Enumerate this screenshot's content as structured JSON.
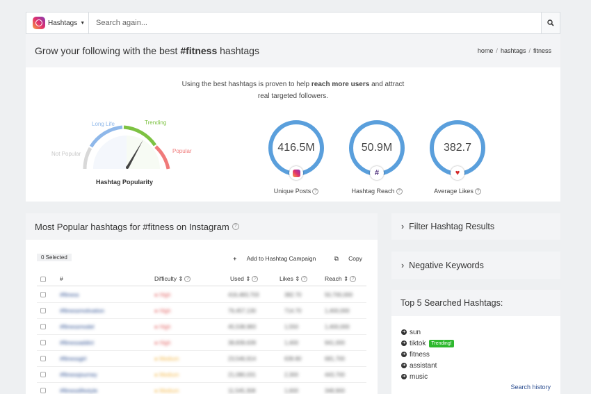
{
  "search": {
    "network_label": "Hashtags",
    "placeholder": "Search again..."
  },
  "header": {
    "title_prefix": "Grow your following with the best ",
    "title_tag": "#fitness",
    "title_suffix": " hashtags",
    "breadcrumbs": [
      "home",
      "hashtags",
      "fitness"
    ]
  },
  "intro": {
    "line1_a": "Using the best hashtags is proven to help ",
    "line1_b": "reach more users",
    "line1_c": " and attract",
    "line2": "real targeted followers."
  },
  "gauge": {
    "labels": {
      "not_popular": "Not Popular",
      "long_life": "Long Life",
      "trending": "Trending",
      "popular": "Popular"
    },
    "title": "Hashtag Popularity",
    "colors": {
      "not_popular": "#d8d8d8",
      "long_life": "#8fb8ea",
      "trending": "#7dc242",
      "popular": "#f07a7a"
    }
  },
  "stats": [
    {
      "value": "416.5M",
      "label": "Unique Posts",
      "icon": "instagram-icon"
    },
    {
      "value": "50.9M",
      "label": "Hashtag Reach",
      "icon": "hash-icon"
    },
    {
      "value": "382.7",
      "label": "Average Likes",
      "icon": "heart-icon"
    }
  ],
  "popular": {
    "title": "Most Popular hashtags for #fitness on Instagram",
    "selected": "0 Selected",
    "add_campaign": "Add to Hashtag Campaign",
    "copy": "Copy",
    "columns": {
      "tag": "#",
      "difficulty": "Difficulty",
      "used": "Used",
      "likes": "Likes",
      "reach": "Reach"
    },
    "rows": [
      {
        "tag": "#fitness",
        "difficulty": "High",
        "used": "416,483,703",
        "likes": "382.70",
        "reach": "50,700,000"
      },
      {
        "tag": "#fitnessmotivation",
        "difficulty": "High",
        "used": "76,457,130",
        "likes": "714.70",
        "reach": "1,400,000"
      },
      {
        "tag": "#fitnessmodel",
        "difficulty": "High",
        "used": "45,538,983",
        "likes": "1,550",
        "reach": "1,400,000"
      },
      {
        "tag": "#fitnessaddict",
        "difficulty": "High",
        "used": "38,839,639",
        "likes": "1,400",
        "reach": "941,000"
      },
      {
        "tag": "#fitnessgirl",
        "difficulty": "Medium",
        "used": "23,546,914",
        "likes": "639.80",
        "reach": "681,700"
      },
      {
        "tag": "#fitnessjourney",
        "difficulty": "Medium",
        "used": "21,080,031",
        "likes": "2,300",
        "reach": "443,700"
      },
      {
        "tag": "#fitnesslifestyle",
        "difficulty": "Medium",
        "used": "11,545,308",
        "likes": "1,600",
        "reach": "348,900"
      }
    ]
  },
  "filters": {
    "filter_results": "Filter Hashtag Results",
    "negative_keywords": "Negative Keywords"
  },
  "top5": {
    "title": "Top 5 Searched Hashtags:",
    "items": [
      {
        "tag": "sun",
        "badge": ""
      },
      {
        "tag": "tiktok",
        "badge": "Trending!"
      },
      {
        "tag": "fitness",
        "badge": ""
      },
      {
        "tag": "assistant",
        "badge": ""
      },
      {
        "tag": "music",
        "badge": ""
      }
    ],
    "history_link": "Search history"
  },
  "colors": {
    "ring": "#5a9fdc",
    "high": "#e05a5a",
    "medium": "#f2b441",
    "link": "#2a4c8f",
    "trending_badge": "#2eb82e"
  }
}
